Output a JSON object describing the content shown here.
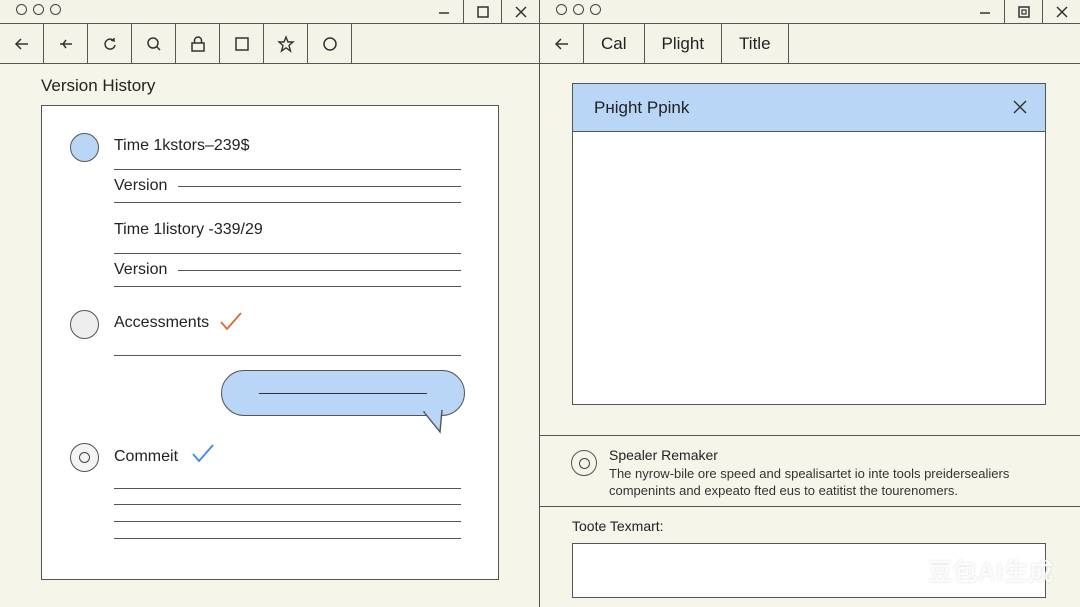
{
  "left_window": {
    "heading": "Version History",
    "entries": [
      {
        "title": "Time 1kstors–239$",
        "version_label": "Version"
      },
      {
        "title": "Time 1listory -339/29",
        "version_label": "Version"
      },
      {
        "title": "Accessments"
      },
      {
        "title": "Commeit"
      }
    ]
  },
  "right_window": {
    "tabs": [
      "Cal",
      "Plight",
      "Title"
    ],
    "dialog": {
      "title": "Pнight Ppink"
    },
    "speaker": {
      "title": "Spealer Remaker",
      "description": "The nyrow-bile ore speed and spealisartet io inte tools preidersealiers compenints and expeato fted eus to eatitist the tourenomers."
    },
    "text_field_label": "Toote Texmart:"
  },
  "watermark": "豆包AI生成",
  "colors": {
    "accent_blue": "#b9d6f7",
    "check_orange": "#e0672e",
    "check_blue": "#3f8ae0",
    "background": "#f6f5ea"
  }
}
